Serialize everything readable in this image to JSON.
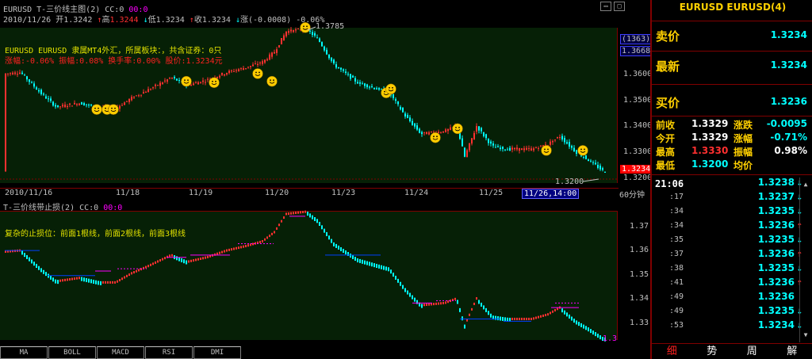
{
  "main": {
    "title": "EURUSD T-三价线主图(2) CC:0",
    "title_extra": "00:0",
    "quote": {
      "date": "2010/11/26",
      "open_label": "开",
      "open": "1.3242",
      "high_label": "高",
      "high": "1.3244",
      "low_label": "低",
      "low": "1.3234",
      "close_label": "收",
      "close": "1.3234",
      "change_label": "涨",
      "change": "(-0.0008)",
      "change_pct": "-0.06%"
    },
    "info_line1": "EURUSD EURUSD 隶属MT4外汇，所属板块：，共含证券：0只",
    "info_line2": "涨幅:-0.06% 振幅:0.08% 换手率:0.00% 股价:1.3234元",
    "peak_label": "1.3785",
    "low_label": "1.3200",
    "y_axis": [
      "1.3600",
      "1.3500",
      "1.3400",
      "1.3300",
      "1.3200"
    ],
    "top_tag1": "(1363)",
    "top_tag2": "1.3668",
    "current_tag": "1.3234"
  },
  "date_axis": {
    "labels": [
      "2010/11/16",
      "11/18",
      "11/19",
      "11/20",
      "11/23",
      "11/24",
      "11/25"
    ],
    "selected": "11/26,14:00",
    "period": "60分钟"
  },
  "indicator": {
    "title": "T-三价线带止损(2) CC:0",
    "title_extra": "00:0",
    "info": "复杂的止损位：前面1根线，前面2根线，前面3根线",
    "y_axis": [
      "1.37",
      "1.36",
      "1.35",
      "1.34",
      "1.33"
    ],
    "current_tag": "1.3"
  },
  "bottom_tabs": [
    "MA",
    "BOLL",
    "MACD",
    "RSI",
    "DMI"
  ],
  "right_panel": {
    "header": "EURUSD EURUSD(4)",
    "big_rows": [
      {
        "label": "卖价",
        "value": "1.3234"
      },
      {
        "label": "最新",
        "value": "1.3234"
      },
      {
        "label": "买价",
        "value": "1.3236"
      }
    ],
    "stats": [
      {
        "l1": "前收",
        "v1": "1.3329",
        "l2": "涨跌",
        "v2": "-0.0095",
        "c1": "#ffffff",
        "c2": "#00ffff"
      },
      {
        "l1": "今开",
        "v1": "1.3329",
        "l2": "涨幅",
        "v2": "-0.71%",
        "c1": "#ffffff",
        "c2": "#00ffff"
      },
      {
        "l1": "最高",
        "v1": "1.3330",
        "l2": "振幅",
        "v2": "0.98%",
        "c1": "#ff3030",
        "c2": "#ffffff"
      },
      {
        "l1": "最低",
        "v1": "1.3200",
        "l2": "均价",
        "v2": "",
        "c1": "#00ffff",
        "c2": "#ffffff"
      }
    ],
    "ticks": [
      {
        "time": "21:06",
        "value": "1.3238",
        "dir": "down"
      },
      {
        "time": ":17",
        "value": "1.3237",
        "dir": "down"
      },
      {
        "time": ":34",
        "value": "1.3235",
        "dir": "down"
      },
      {
        "time": ":34",
        "value": "1.3236",
        "dir": "up"
      },
      {
        "time": ":35",
        "value": "1.3235",
        "dir": "down"
      },
      {
        "time": ":37",
        "value": "1.3236",
        "dir": "up"
      },
      {
        "time": ":38",
        "value": "1.3235",
        "dir": "down"
      },
      {
        "time": ":41",
        "value": "1.3236",
        "dir": "up"
      },
      {
        "time": ":49",
        "value": "1.3236",
        "dir": ""
      },
      {
        "time": ":49",
        "value": "1.3235",
        "dir": "down"
      },
      {
        "time": ":53",
        "value": "1.3234",
        "dir": "down"
      }
    ],
    "tabs": [
      "细",
      "势",
      "周",
      "解"
    ],
    "active_tab": 0
  },
  "colors": {
    "up": "#ff3030",
    "down": "#00ffff",
    "panel_bg": "#062006",
    "grid": "#800000",
    "label_yellow": "#ffd000",
    "stop_line_blue": "#0040ff",
    "stop_line_magenta": "#ff00ff"
  }
}
